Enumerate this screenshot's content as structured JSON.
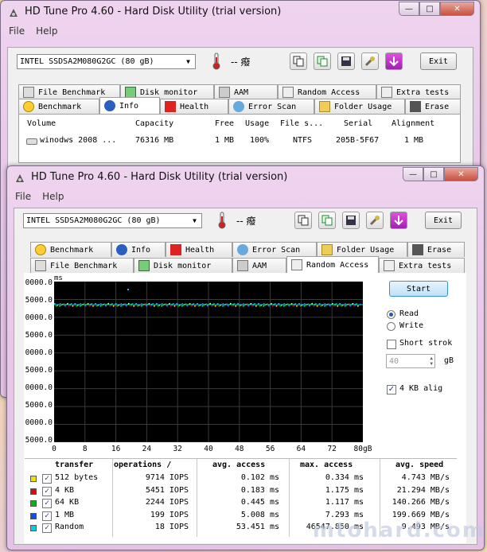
{
  "back_window": {
    "title": "HD Tune Pro 4.60 - Hard Disk Utility (trial version)",
    "menu": [
      "File",
      "Help"
    ],
    "drive": "INTEL SSDSA2M080G2GC  (80 gB)",
    "temperature": "-- 癈",
    "exit_label": "Exit",
    "tabs_row1": [
      "File Benchmark",
      "Disk monitor",
      "AAM",
      "Random Access",
      "Extra tests"
    ],
    "tabs_row2": [
      "Benchmark",
      "Info",
      "Health",
      "Error Scan",
      "Folder Usage",
      "Erase"
    ],
    "active_tab": "Info",
    "info_headers": [
      "Volume",
      "Capacity",
      "Free",
      "Usage",
      "File s...",
      "Serial",
      "Alignment"
    ],
    "info_row": [
      "winodws 2008 ...",
      "76316 MB",
      "1 MB",
      "100%",
      "NTFS",
      "205B-5F67",
      "1 MB"
    ]
  },
  "front_window": {
    "title": "HD Tune Pro 4.60 - Hard Disk Utility (trial version)",
    "menu": [
      "File",
      "Help"
    ],
    "drive": "INTEL SSDSA2M080G2GC  (80 gB)",
    "temperature": "-- 癈",
    "exit_label": "Exit",
    "tabs_row1": [
      "Benchmark",
      "Info",
      "Health",
      "Error Scan",
      "Folder Usage",
      "Erase"
    ],
    "tabs_row2": [
      "File Benchmark",
      "Disk monitor",
      "AAM",
      "Random Access",
      "Extra tests"
    ],
    "active_tab": "Random Access",
    "start_label": "Start",
    "read_label": "Read",
    "write_label": "Write",
    "short_stroke_label": "Short strok",
    "short_stroke_value": "40",
    "short_stroke_unit": "gB",
    "align_label": "4 KB alig"
  },
  "chart_data": {
    "type": "scatter",
    "y_unit": "ms",
    "y_ticks": [
      "0000.0",
      "5000.0",
      "0000.0",
      "5000.0",
      "0000.0",
      "5000.0",
      "0000.0",
      "5000.0",
      "0000.0",
      "5000.0"
    ],
    "x_ticks": [
      "0",
      "8",
      "16",
      "24",
      "32",
      "40",
      "48",
      "56",
      "64",
      "72",
      "80gB"
    ],
    "series": [
      {
        "color": "#00d0e0"
      },
      {
        "color": "#00c000"
      },
      {
        "color": "#ffff00"
      },
      {
        "color": "#d00000"
      },
      {
        "color": "#3a5cff"
      }
    ]
  },
  "results": {
    "headers": [
      "transfer",
      "operations /",
      "avg. access",
      "max. access",
      "avg. speed"
    ],
    "rows": [
      {
        "color": "#f0e000",
        "label": "512 bytes",
        "ops": "9714 IOPS",
        "avg": "0.102 ms",
        "max": "0.334 ms",
        "speed": "4.743 MB/s"
      },
      {
        "color": "#d01010",
        "label": "4 KB",
        "ops": "5451 IOPS",
        "avg": "0.183 ms",
        "max": "1.175 ms",
        "speed": "21.294 MB/s"
      },
      {
        "color": "#10b010",
        "label": "64 KB",
        "ops": "2244 IOPS",
        "avg": "0.445 ms",
        "max": "1.117 ms",
        "speed": "140.266 MB/s"
      },
      {
        "color": "#1050e0",
        "label": "1 MB",
        "ops": "199 IOPS",
        "avg": "5.008 ms",
        "max": "7.293 ms",
        "speed": "199.669 MB/s"
      },
      {
        "color": "#10c8e0",
        "label": "Random",
        "ops": "18 IOPS",
        "avg": "53.451 ms",
        "max": "46547.850 ms",
        "speed": "9.493 MB/s"
      }
    ]
  },
  "watermark": "mtohard.com"
}
